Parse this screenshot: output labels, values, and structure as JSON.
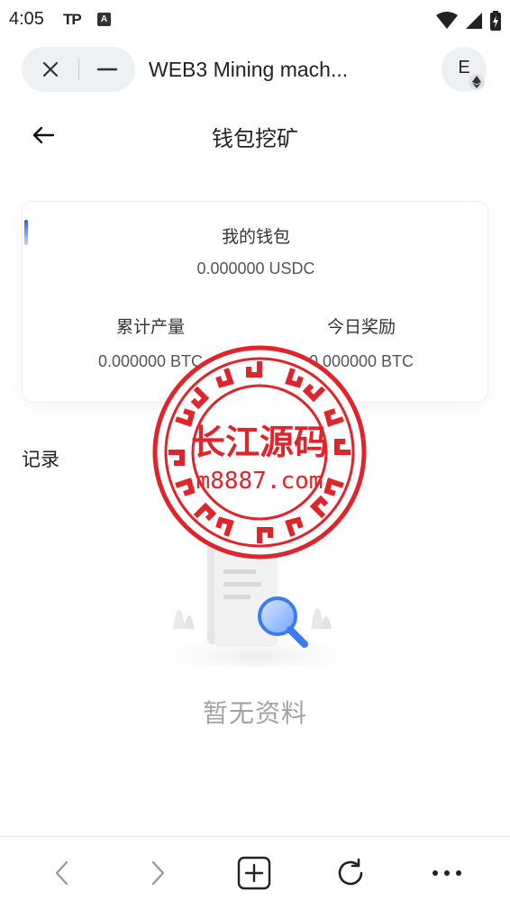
{
  "status_bar": {
    "time": "4:05",
    "tp_label": "TP",
    "a_label": "A"
  },
  "browser": {
    "tab_title": "WEB3 Mining mach...",
    "account_letter": "E",
    "icons": [
      "close-icon",
      "minimize-icon",
      "ethereum-icon"
    ]
  },
  "page": {
    "title": "钱包挖矿"
  },
  "wallet": {
    "label": "我的钱包",
    "balance": "0.000000 USDC",
    "stats": [
      {
        "label": "累计产量",
        "value": "0.000000 BTC"
      },
      {
        "label": "今日奖励",
        "value": "0.000000 BTC"
      }
    ],
    "accent_color": "#2c5bf5"
  },
  "records": {
    "title": "记录",
    "empty_text": "暂无资料"
  },
  "watermark": {
    "line1": "长江源码",
    "line2": "m8887.com",
    "color": "#e0242b"
  },
  "bottom_nav": {
    "icons": [
      "back-icon",
      "forward-icon",
      "new-tab-icon",
      "refresh-icon",
      "more-icon"
    ]
  }
}
